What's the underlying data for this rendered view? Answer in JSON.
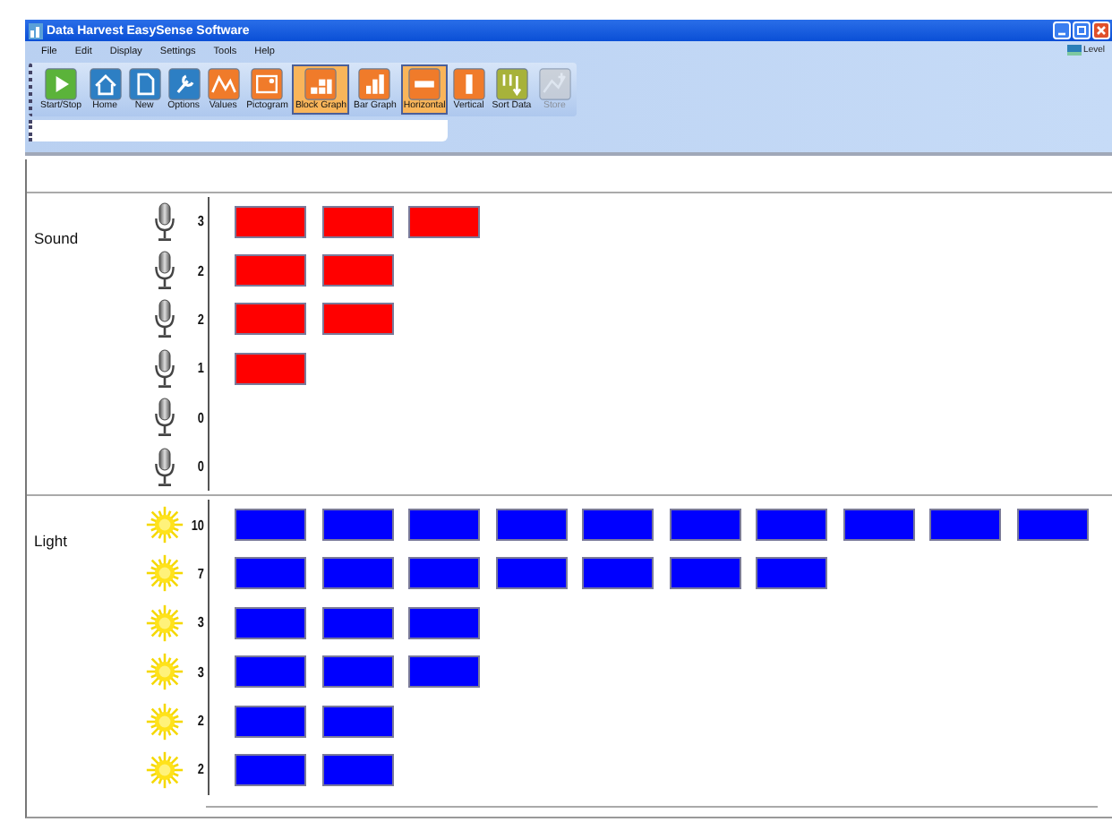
{
  "window": {
    "title": "Data Harvest EasySense Software"
  },
  "menu": [
    "File",
    "Edit",
    "Display",
    "Settings",
    "Tools",
    "Help"
  ],
  "toolbar": [
    {
      "label": "Start/Stop",
      "selected": false,
      "disabled": false
    },
    {
      "label": "Home",
      "selected": false,
      "disabled": false
    },
    {
      "label": "New",
      "selected": false,
      "disabled": false
    },
    {
      "label": "Options",
      "selected": false,
      "disabled": false
    },
    {
      "label": "Values",
      "selected": false,
      "disabled": false
    },
    {
      "label": "Pictogram",
      "selected": false,
      "disabled": false
    },
    {
      "label": "Block Graph",
      "selected": true,
      "disabled": false
    },
    {
      "label": "Bar Graph",
      "selected": false,
      "disabled": false
    },
    {
      "label": "Horizontal",
      "selected": true,
      "disabled": false
    },
    {
      "label": "Vertical",
      "selected": false,
      "disabled": false
    },
    {
      "label": "Sort Data",
      "selected": false,
      "disabled": false
    },
    {
      "label": "Store",
      "selected": false,
      "disabled": true
    }
  ],
  "level_button": {
    "label": "Level"
  },
  "groups": [
    {
      "name": "Sound",
      "kind": "sound",
      "color": "#ff0000",
      "rows": [
        "3",
        "2",
        "2",
        "1",
        "0",
        "0"
      ]
    },
    {
      "name": "Light",
      "kind": "light",
      "color": "#0000ff",
      "rows": [
        "10",
        "7",
        "3",
        "3",
        "2",
        "2"
      ]
    }
  ]
}
